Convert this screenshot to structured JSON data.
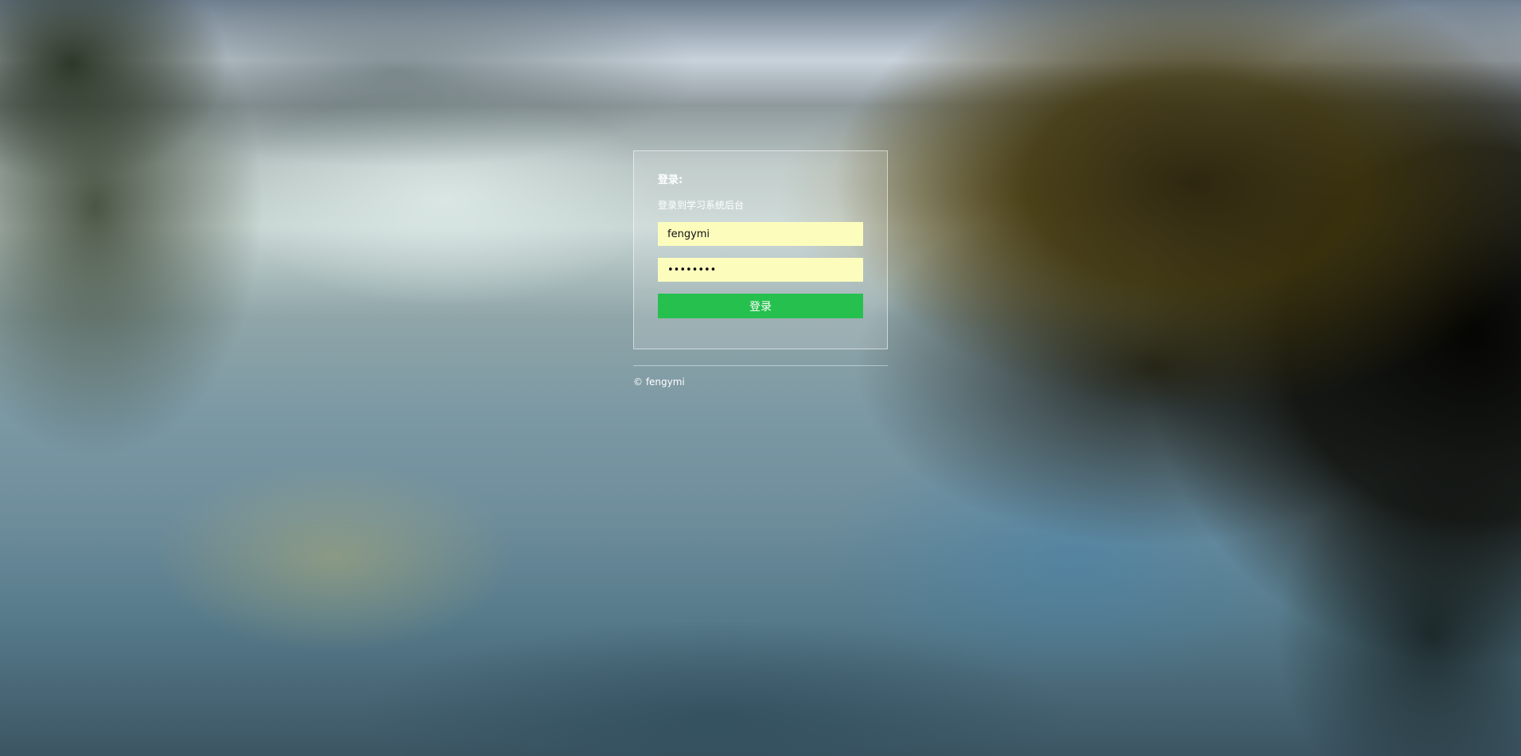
{
  "login": {
    "title": "登录:",
    "description": "登录到学习系统后台",
    "username_value": "fengymi",
    "password_value": "••••••••",
    "submit_label": "登录"
  },
  "footer": {
    "copyright": "© fengymi"
  },
  "colors": {
    "input_background": "#fcfdbd",
    "button_background": "#26c04f",
    "text": "#ffffff"
  }
}
